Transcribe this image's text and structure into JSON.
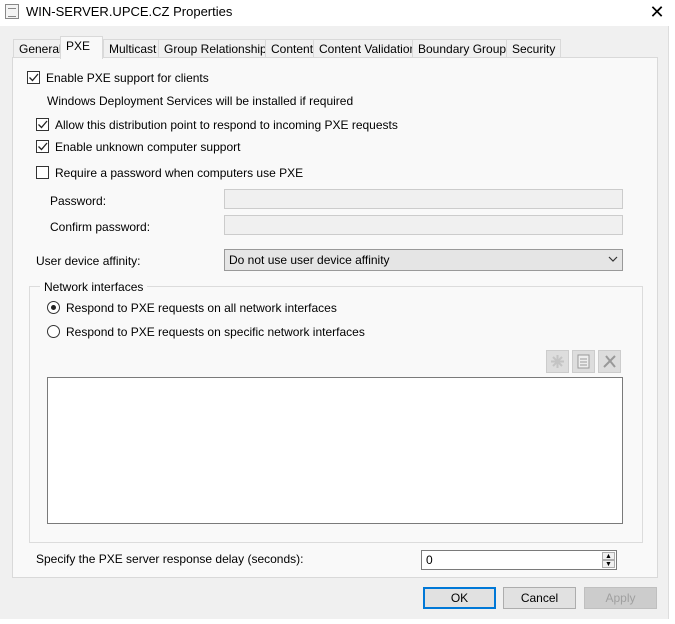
{
  "window": {
    "title": "WIN-SERVER.UPCE.CZ Properties",
    "close": "✕"
  },
  "tabs": [
    {
      "label": "General"
    },
    {
      "label": "PXE",
      "active": true
    },
    {
      "label": "Multicast"
    },
    {
      "label": "Group Relationships"
    },
    {
      "label": "Content"
    },
    {
      "label": "Content Validation"
    },
    {
      "label": "Boundary Groups"
    },
    {
      "label": "Security"
    }
  ],
  "pxe": {
    "enable_pxe": {
      "label": "Enable PXE support for clients",
      "checked": true
    },
    "wds_note": "Windows Deployment Services will be installed if required",
    "allow_respond": {
      "label": "Allow this distribution point to respond to incoming PXE requests",
      "checked": true
    },
    "unknown_support": {
      "label": "Enable unknown computer support",
      "checked": true
    },
    "require_password": {
      "label": "Require a password when computers use PXE",
      "checked": false
    },
    "password_label": "Password:",
    "password_value": "",
    "confirm_label": "Confirm password:",
    "confirm_value": "",
    "affinity_label": "User device affinity:",
    "affinity_value": "Do not use user device affinity",
    "network": {
      "group_label": "Network interfaces",
      "all": {
        "label": "Respond to PXE requests on all network interfaces",
        "selected": true
      },
      "specific": {
        "label": "Respond to PXE requests on specific network interfaces",
        "selected": false
      },
      "toolbar": [
        "new-icon",
        "properties-icon",
        "delete-icon"
      ]
    },
    "delay_label": "Specify the PXE server response delay (seconds):",
    "delay_value": "0"
  },
  "buttons": {
    "ok": "OK",
    "cancel": "Cancel",
    "apply": "Apply"
  },
  "colors": {
    "accent": "#0078d7",
    "dialog_bg": "#f0f0f0"
  }
}
